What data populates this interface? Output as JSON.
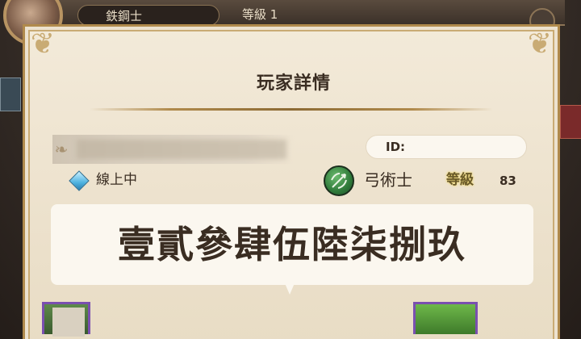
{
  "background": {
    "name_pill_text": "鉄鋼士",
    "level_text": "等級 1"
  },
  "dialog": {
    "title": "玩家詳情",
    "id_label": "ID:",
    "status_text": "線上中",
    "class_icon": "bow-arrow-icon",
    "class_name": "弓術士",
    "level_label": "等級",
    "level_value": "83",
    "message": "壹貳參肆伍陸柒捌玖"
  },
  "colors": {
    "panel_bg": "#ece1cc",
    "panel_border": "#b08a4c",
    "text_dark": "#3a2d22",
    "status_diamond": "#4fb3e0",
    "class_icon_green": "#2f7a3a",
    "card_border_purple": "#7a4fb0"
  }
}
